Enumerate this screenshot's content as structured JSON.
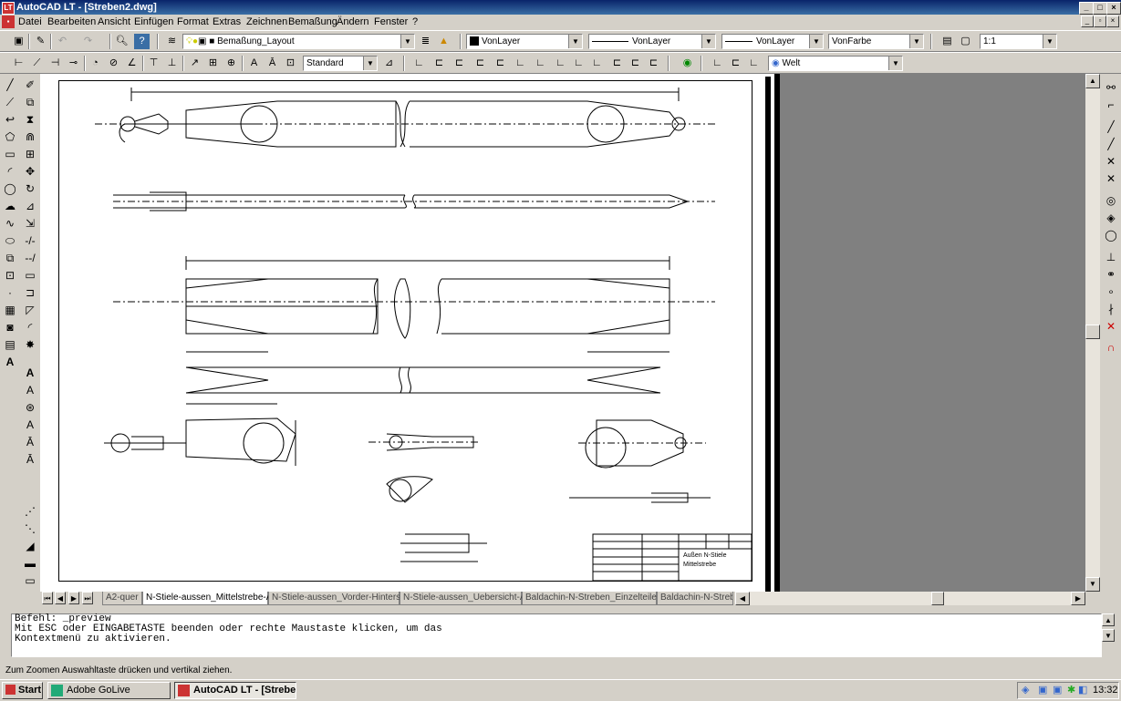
{
  "window": {
    "title": "AutoCAD LT - [Streben2.dwg]",
    "app_icon": "LT"
  },
  "menu": [
    "Datei",
    "Bearbeiten",
    "Ansicht",
    "Einfügen",
    "Format",
    "Extras",
    "Zeichnen",
    "Bemaßung",
    "Ändern",
    "Fenster",
    "?"
  ],
  "toolbar_top": {
    "layer_combo": "Bemaßung_Layout",
    "color_combo": "VonLayer",
    "linetype_combo": "VonLayer",
    "lineweight_combo": "VonLayer",
    "plotstyle_combo": "VonFarbe",
    "scale_combo": "1:1"
  },
  "toolbar_dim": {
    "dimstyle_combo": "Standard",
    "ucs_combo": "Welt"
  },
  "tabs": [
    "A2-quer",
    "N-Stiele-aussen_Mittelstrebe-A1",
    "N-Stiele-aussen_Vorder-Hinterst...",
    "N-Stiele-aussen_Uebersicht-A1",
    "Baldachin-N-Streben_Einzelteile...",
    "Baldachin-N-Streb"
  ],
  "active_tab": "N-Stiele-aussen_Mittelstrebe-A1",
  "command_lines": [
    "Befehl: _preview",
    "Mit ESC oder EINGABETASTE beenden oder rechte Maustaste klicken, um das",
    "Kontextmenü zu aktivieren."
  ],
  "status_text": "Zum Zoomen Auswahltaste drücken und vertikal ziehen.",
  "titleblock": {
    "name_line1": "Außen N-Stiele",
    "name_line2": "Mittelstrebe"
  },
  "taskbar": {
    "start_label": "Start",
    "tasks": [
      "Adobe GoLive",
      "AutoCAD LT - [Strebe..."
    ],
    "clock": "13:32"
  }
}
